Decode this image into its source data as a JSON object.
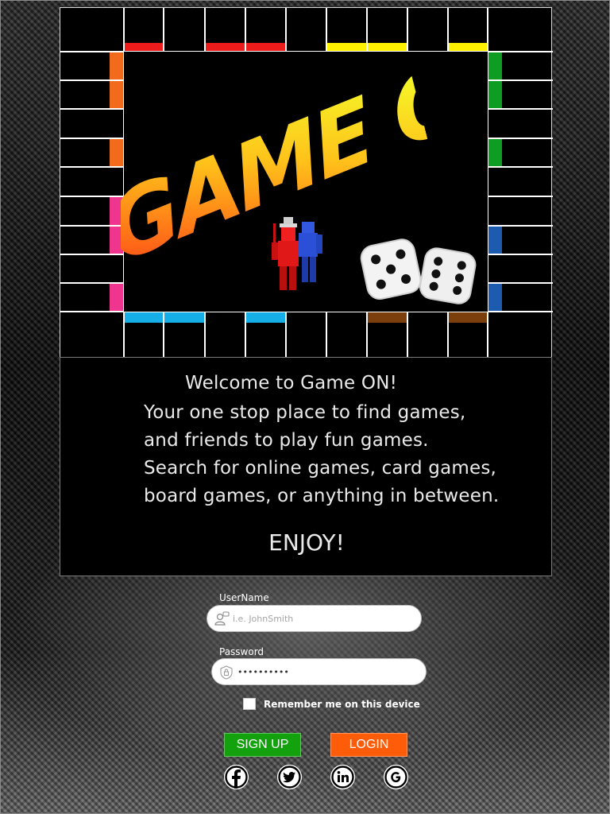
{
  "board": {
    "title_art": "GAME ON!",
    "colors": {
      "red": "#ee1b1b",
      "yellow": "#fff200",
      "orange": "#f26b1d",
      "pink": "#f0358f",
      "green": "#0e9c22",
      "blue": "#1c5bb0",
      "cyan": "#16aee6",
      "brown": "#7a3f0a"
    }
  },
  "welcome": {
    "heading": "Welcome to Game ON!",
    "lines": [
      "Your one stop place to find games,",
      "and friends to play fun games.",
      "Search for online games, card games,",
      "board games, or anything in between."
    ],
    "closing": "ENJOY!"
  },
  "login": {
    "username_label": "UserName",
    "username_placeholder": "i.e. JohnSmith",
    "username_icon": "user-icon",
    "password_label": "Password",
    "password_value": "**********",
    "password_icon": "lock-icon",
    "remember_label": "Remember me on this device",
    "signup_label": "SIGN UP",
    "login_label": "LOGIN",
    "signup_color": "#14a10e",
    "login_color": "#ff5c0a"
  },
  "social": [
    {
      "icon": "facebook-icon"
    },
    {
      "icon": "twitter-icon"
    },
    {
      "icon": "linkedin-icon"
    },
    {
      "icon": "google-icon"
    }
  ]
}
